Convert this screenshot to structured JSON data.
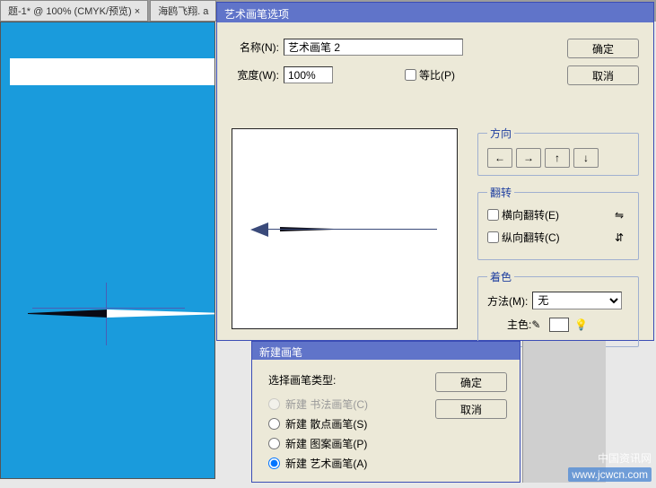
{
  "tabs": {
    "active": "题-1* @ 100% (CMYK/预览) ×",
    "inactive": "海鸥飞翔. a"
  },
  "dialog_main": {
    "title": "艺术画笔选项",
    "name_label": "名称(N):",
    "name_value": "艺术画笔 2",
    "width_label": "宽度(W):",
    "width_value": "100%",
    "proportional_label": "等比(P)",
    "ok": "确定",
    "cancel": "取消",
    "direction_legend": "方向",
    "dir_left": "←",
    "dir_right": "→",
    "dir_up": "↑",
    "dir_down": "↓",
    "flip_legend": "翻转",
    "flip_h": "横向翻转(E)",
    "flip_v": "纵向翻转(C)",
    "color_legend": "着色",
    "method_label": "方法(M):",
    "method_value": "无",
    "keycolor_label": "主色:"
  },
  "dialog_sub": {
    "title": "新建画笔",
    "heading": "选择画笔类型:",
    "options": {
      "calligraphy": "新建 书法画笔(C)",
      "scatter": "新建 散点画笔(S)",
      "pattern": "新建 图案画笔(P)",
      "art": "新建 艺术画笔(A)"
    },
    "ok": "确定",
    "cancel": "取消"
  },
  "watermark": {
    "text": "中国资讯网",
    "url": "www.jcwcn.com"
  }
}
